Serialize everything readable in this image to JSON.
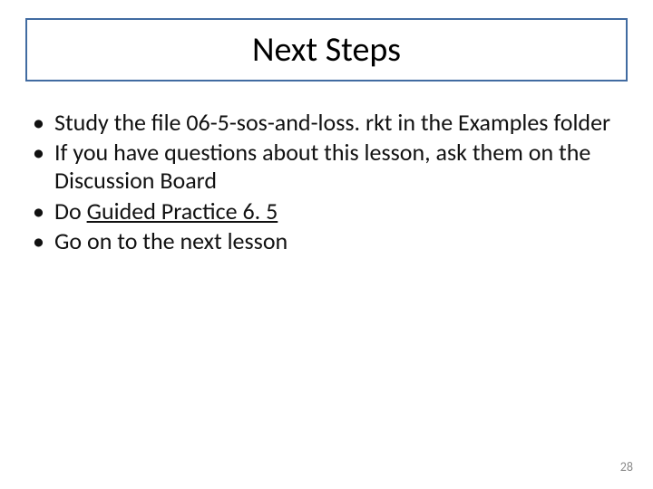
{
  "title": "Next Steps",
  "bullets": {
    "b0": "Study the file 06-5-sos-and-loss. rkt in the Examples folder",
    "b1": "If you have questions about this lesson, ask them on the Discussion Board",
    "b2_prefix": "Do ",
    "b2_link": "Guided Practice 6. 5",
    "b3": "Go on to the next lesson"
  },
  "page_number": "28"
}
